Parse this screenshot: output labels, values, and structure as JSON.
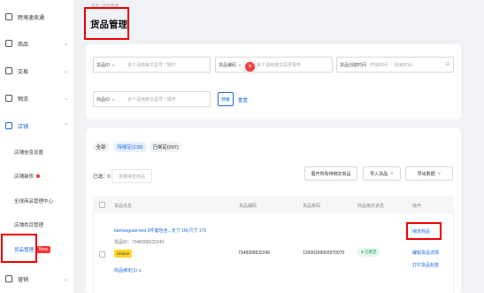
{
  "sidebar": {
    "items": [
      {
        "label": "跨境速卖通"
      },
      {
        "label": "商品"
      },
      {
        "label": "交易"
      },
      {
        "label": "物流"
      },
      {
        "label": "店铺"
      }
    ],
    "sub_items": [
      {
        "label": "店铺信息设置"
      },
      {
        "label": "店铺装修"
      },
      {
        "label": "全球商品管理中心"
      },
      {
        "label": "店铺类目管理"
      },
      {
        "label": "货品管理",
        "badge": "New"
      }
    ],
    "last_item": {
      "label": "营销"
    }
  },
  "header": {
    "breadcrumb": "首页 / 货品管理",
    "title": "货品管理"
  },
  "filters": {
    "product_id_select": "货品ID",
    "product_id_placeholder": "多个请用英文逗号“,”隔开",
    "merchant_code_select": "货品编码",
    "merchant_code_placeholder": "多个请用英文逗号隔开",
    "create_time_label": "货品创建时间",
    "start_placeholder": "开始时间",
    "end_placeholder": "结束时间",
    "item_id_select": "商品ID",
    "item_id_placeholder": "多个请用英文逗号“,”隔开",
    "search_button": "搜索",
    "reset_button": "重置"
  },
  "tabs": [
    {
      "label": "全部",
      "active": false
    },
    {
      "label": "待绑定(238)",
      "active": true
    },
    {
      "label": "已绑定(997)",
      "active": false
    }
  ],
  "toolbar": {
    "selected_label": "已选：0",
    "batch_bind": "批量绑定商品",
    "expand_button": "展开所有待绑定商品",
    "import_button": "导入货品",
    "export_button": "导出数据"
  },
  "table": {
    "columns": [
      "货品信息",
      "货品编码",
      "货品条码",
      "商品绑定状态",
      "操作"
    ],
    "rows": [
      {
        "name": "bantuoguan-test-3件套包含...天寸 1M,尺寸 176",
        "product_id": "货品ID：7348399632240",
        "tag": "Choice",
        "bound_link": "商品绑定(1) ∨",
        "code": "7348399632240",
        "barcode": "12000399993970070",
        "status": "已绑定",
        "actions": [
          "绑定商品",
          "编辑货品详情",
          "打印货品标签"
        ]
      }
    ]
  },
  "colors": {
    "accent": "#1a6be0",
    "highlight": "#e00000",
    "tag": "#ffd426"
  }
}
